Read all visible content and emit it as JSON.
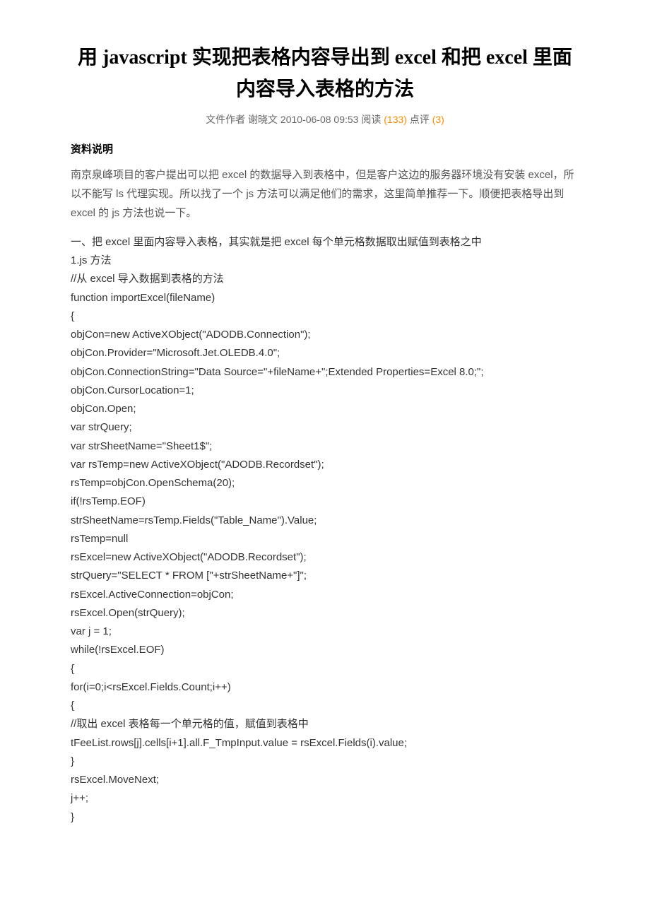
{
  "title": "用 javascript 实现把表格内容导出到 excel 和把 excel 里面内容导入表格的方法",
  "meta": {
    "prefix": "文件作者 谢晓文 2010-06-08 09:53 阅读",
    "reads": "(133)",
    "mid": "点评",
    "comments": "(3)"
  },
  "section_heading": "资料说明",
  "description": "南京泉峰项目的客户提出可以把 excel 的数据导入到表格中，但是客户这边的服务器环境没有安装 excel，所以不能写 ls 代理实现。所以找了一个 js 方法可以满足他们的需求，这里简单推荐一下。顺便把表格导出到 excel 的 js 方法也说一下。",
  "code": "一、把 excel 里面内容导入表格，其实就是把 excel 每个单元格数据取出赋值到表格之中\n1.js 方法\n//从 excel 导入数据到表格的方法\nfunction importExcel(fileName)\n{\nobjCon=new ActiveXObject(\"ADODB.Connection\");\nobjCon.Provider=\"Microsoft.Jet.OLEDB.4.0\";\nobjCon.ConnectionString=\"Data Source=\"+fileName+\";Extended Properties=Excel 8.0;\";\nobjCon.CursorLocation=1;\nobjCon.Open;\nvar strQuery;\nvar strSheetName=\"Sheet1$\";\nvar rsTemp=new ActiveXObject(\"ADODB.Recordset\");\nrsTemp=objCon.OpenSchema(20);\nif(!rsTemp.EOF)\nstrSheetName=rsTemp.Fields(\"Table_Name\").Value;\nrsTemp=null\nrsExcel=new ActiveXObject(\"ADODB.Recordset\");\nstrQuery=\"SELECT * FROM [\"+strSheetName+\"]\";\nrsExcel.ActiveConnection=objCon;\nrsExcel.Open(strQuery);\nvar j = 1;\nwhile(!rsExcel.EOF)\n{\nfor(i=0;i<rsExcel.Fields.Count;i++)\n{\n//取出 excel 表格每一个单元格的值，赋值到表格中\ntFeeList.rows[j].cells[i+1].all.F_TmpInput.value = rsExcel.Fields(i).value;\n}\nrsExcel.MoveNext;\nj++;\n}"
}
